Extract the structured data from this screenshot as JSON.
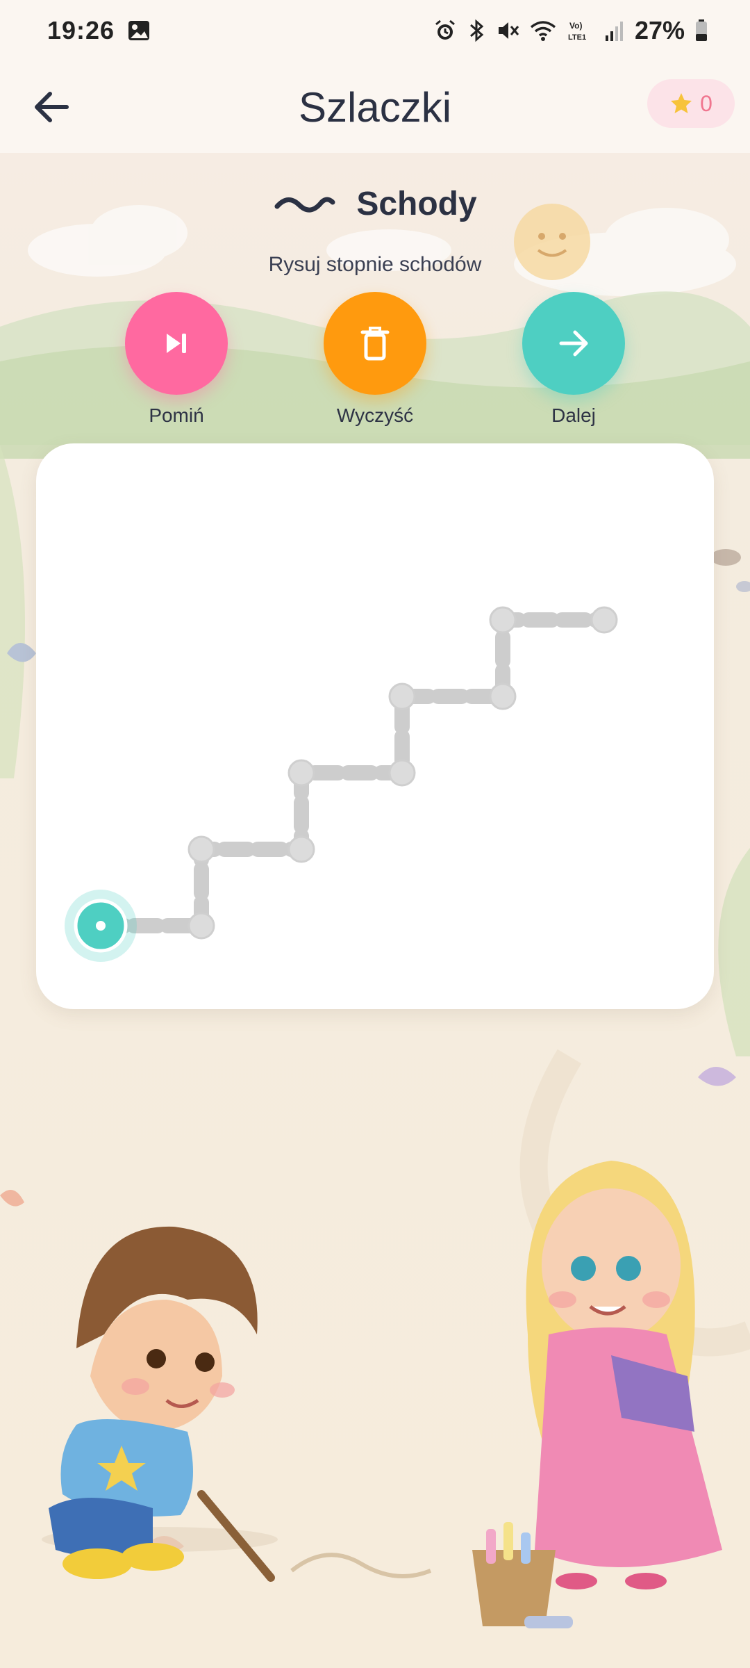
{
  "status_bar": {
    "time": "19:26",
    "battery_percent": "27%",
    "icons": [
      "gallery-icon",
      "alarm-icon",
      "bluetooth-icon",
      "mute-icon",
      "wifi-icon",
      "volte-icon",
      "signal-icon",
      "battery-icon"
    ]
  },
  "app_bar": {
    "title": "Szlaczki",
    "star_count": "0"
  },
  "exercise": {
    "name": "Schody",
    "instruction": "Rysuj stopnie schodów"
  },
  "actions": {
    "skip_label": "Pomiń",
    "clear_label": "Wyczyść",
    "next_label": "Dalej"
  },
  "colors": {
    "skip": "#ff69a0",
    "clear": "#ff9a0e",
    "next": "#4ecfc2",
    "path": "#c9c9c9",
    "start_point": "#4ecfc2"
  }
}
